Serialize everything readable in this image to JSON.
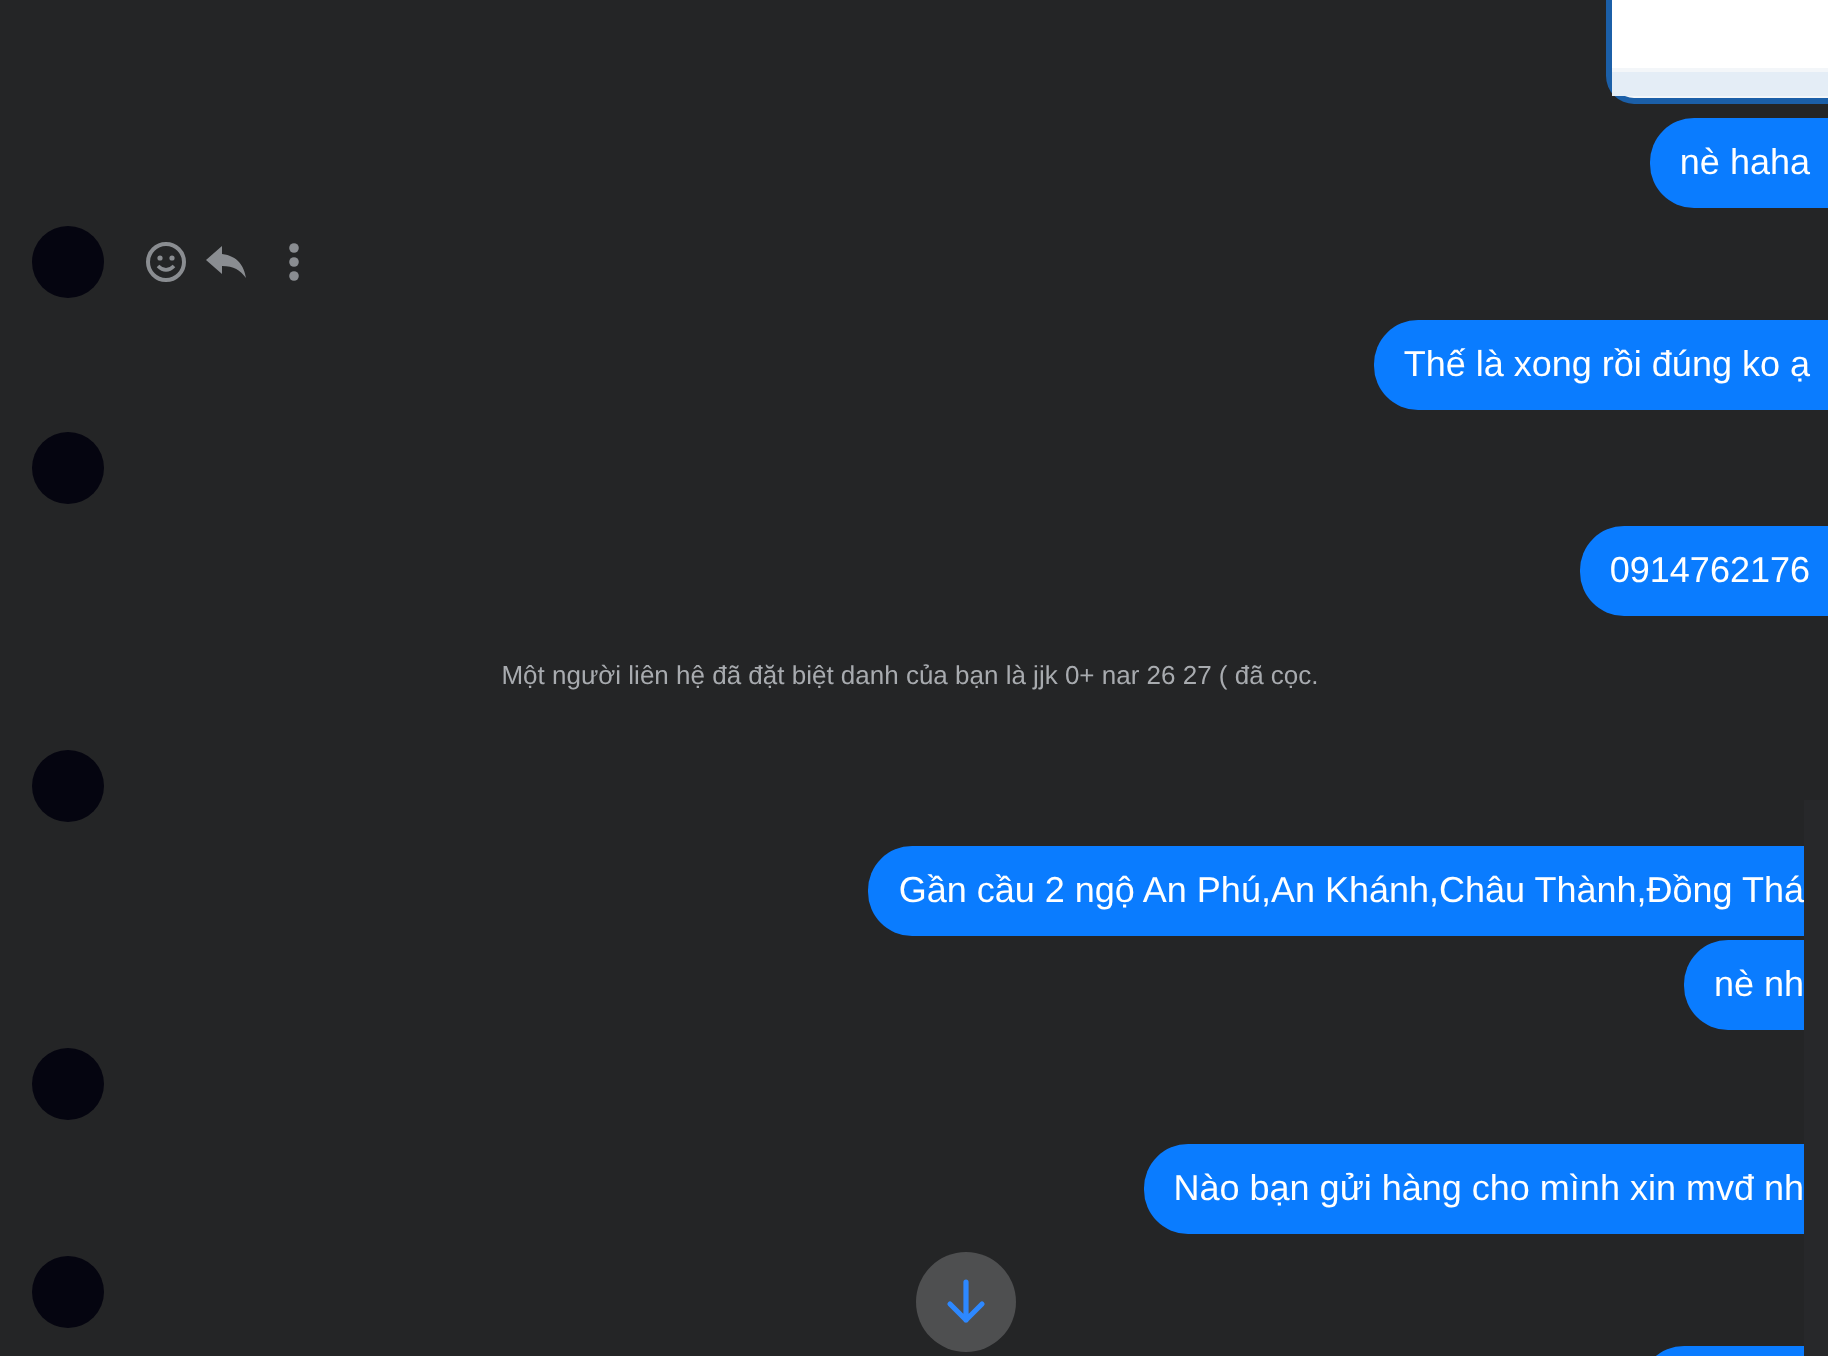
{
  "messages": [
    {
      "kind": "image"
    },
    {
      "kind": "outgoing",
      "text": "nè haha",
      "cut": false
    },
    {
      "kind": "avatar",
      "actions": true
    },
    {
      "kind": "outgoing",
      "text": "Thế là xong rồi đúng ko ạ",
      "cut": false
    },
    {
      "kind": "avatar",
      "actions": false
    },
    {
      "kind": "outgoing",
      "text": "0914762176",
      "cut": false
    },
    {
      "kind": "system",
      "text": "Một người liên hệ đã đặt biệt danh của bạn là jjk 0+ nar 26 27 ( đã cọc."
    },
    {
      "kind": "avatar",
      "actions": false
    },
    {
      "kind": "outgoing",
      "text": "Gần cầu 2 ngộ An Phú,An Khánh,Châu Thành,Đồng Thá",
      "cut": true
    },
    {
      "kind": "outgoing",
      "text": "nè nh",
      "cut": true
    },
    {
      "kind": "avatar",
      "actions": false
    },
    {
      "kind": "outgoing",
      "text": "Nào bạn gửi hàng cho mình xin mvđ nh",
      "cut": true
    },
    {
      "kind": "avatar",
      "actions": false
    },
    {
      "kind": "outgoing",
      "cut": true
    }
  ]
}
